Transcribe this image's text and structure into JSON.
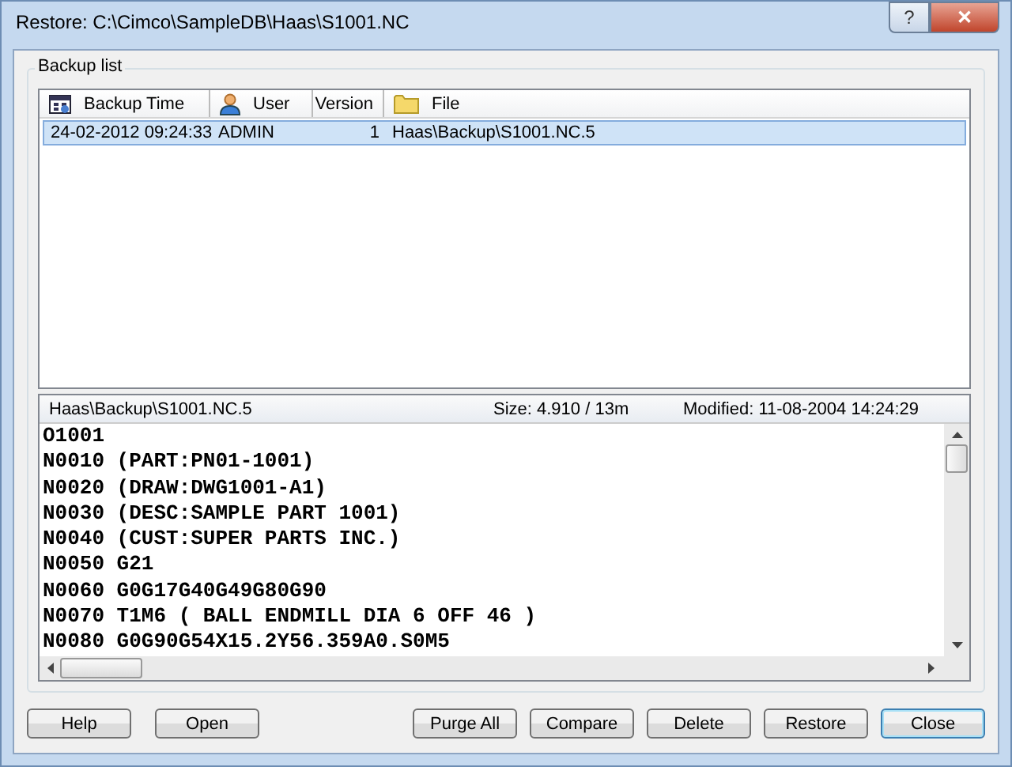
{
  "window": {
    "title": "Restore: C:\\Cimco\\SampleDB\\Haas\\S1001.NC",
    "help": "?",
    "close": "✕"
  },
  "group": {
    "label": "Backup list"
  },
  "columns": [
    {
      "label": "Backup Time"
    },
    {
      "label": "User"
    },
    {
      "label": "Version"
    },
    {
      "label": "File"
    }
  ],
  "rows": [
    {
      "selected": true,
      "cells": [
        "24-02-2012 09:24:33",
        "ADMIN",
        "1",
        "Haas\\Backup\\S1001.NC.5"
      ]
    }
  ],
  "preview": {
    "file": "Haas\\Backup\\S1001.NC.5",
    "size": "Size: 4.910 / 13m",
    "modified": "Modified: 11-08-2004 14:24:29",
    "lines": [
      "O1001",
      "N0010 (PART:PN01-1001)",
      "N0020 (DRAW:DWG1001-A1)",
      "N0030 (DESC:SAMPLE PART 1001)",
      "N0040 (CUST:SUPER PARTS INC.)",
      "N0050 G21",
      "N0060 G0G17G40G49G80G90",
      "N0070 T1M6 ( BALL ENDMILL DIA 6 OFF 46 )",
      "N0080 G0G90G54X15.2Y56.359A0.S0M5"
    ]
  },
  "left_buttons": [
    {
      "label": "Help",
      "default": false
    },
    {
      "label": "Open",
      "default": false
    }
  ],
  "right_buttons": [
    {
      "label": "Purge All",
      "default": false
    },
    {
      "label": "Compare",
      "default": false
    },
    {
      "label": "Delete",
      "default": false
    },
    {
      "label": "Restore",
      "default": false
    },
    {
      "label": "Close",
      "default": true
    }
  ]
}
